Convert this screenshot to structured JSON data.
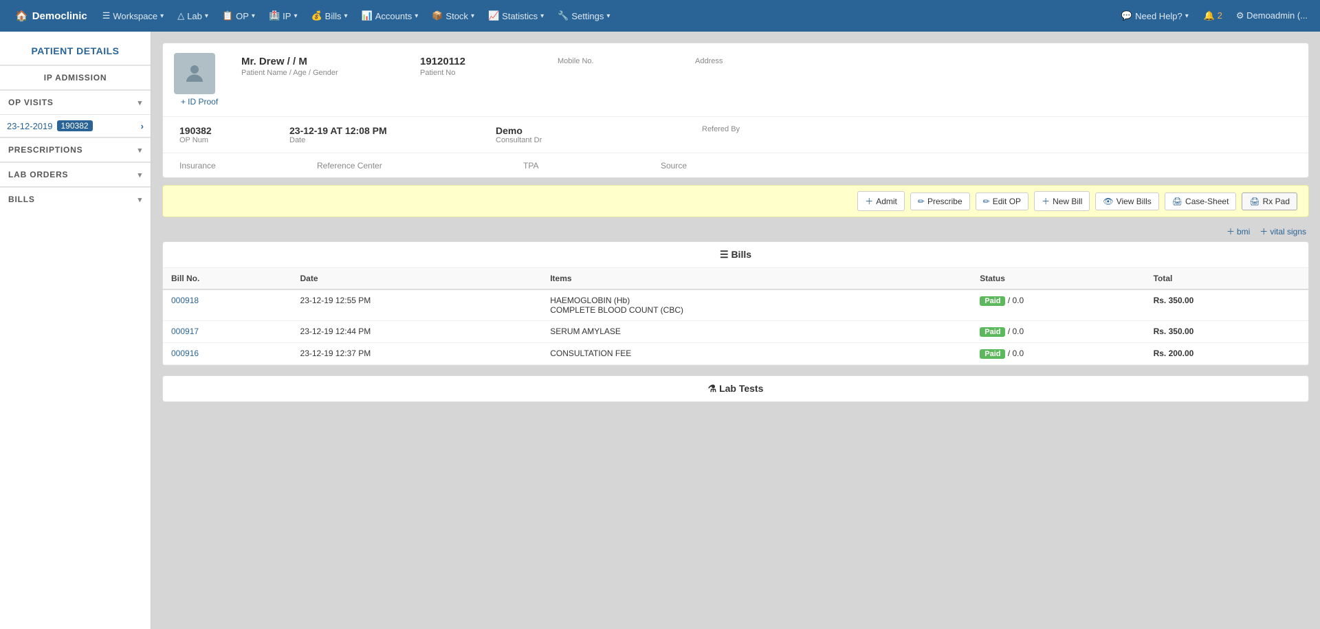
{
  "brand": {
    "icon": "🏠",
    "name": "Democlinic"
  },
  "nav": {
    "items": [
      {
        "id": "workspace",
        "label": "Workspace",
        "icon": "☰",
        "has_caret": true
      },
      {
        "id": "lab",
        "label": "Lab",
        "icon": "△",
        "has_caret": true
      },
      {
        "id": "op",
        "label": "OP",
        "icon": "📋",
        "has_caret": true
      },
      {
        "id": "ip",
        "label": "IP",
        "icon": "🏥",
        "has_caret": true
      },
      {
        "id": "bills",
        "label": "Bills",
        "icon": "💰",
        "has_caret": true
      },
      {
        "id": "accounts",
        "label": "Accounts",
        "icon": "📊",
        "has_caret": true
      },
      {
        "id": "stock",
        "label": "Stock",
        "icon": "📦",
        "has_caret": true
      },
      {
        "id": "statistics",
        "label": "Statistics",
        "icon": "📈",
        "has_caret": true
      },
      {
        "id": "settings",
        "label": "Settings",
        "icon": "🔧",
        "has_caret": true
      }
    ],
    "help": "Need Help?",
    "bell_count": "2",
    "admin": "Demoadmin (..."
  },
  "sidebar": {
    "title": "PATIENT DETAILS",
    "sections": [
      {
        "id": "ip-admission",
        "label": "IP ADMISSION",
        "has_caret": false
      },
      {
        "id": "op-visits",
        "label": "OP VISITS",
        "has_caret": true
      },
      {
        "id": "prescriptions",
        "label": "PRESCRIPTIONS",
        "has_caret": true
      },
      {
        "id": "lab-orders",
        "label": "LAB ORDERS",
        "has_caret": true
      },
      {
        "id": "bills",
        "label": "BILLS",
        "has_caret": true
      }
    ],
    "visit_date": "23-12-2019",
    "visit_badge": "190382"
  },
  "patient": {
    "name": "Mr. Drew / / M",
    "name_label": "Patient Name / Age / Gender",
    "number": "19120112",
    "number_label": "Patient No",
    "mobile_label": "Mobile No.",
    "address_label": "Address",
    "id_proof": "+ ID Proof"
  },
  "visit": {
    "op_num": "190382",
    "op_num_label": "OP Num",
    "date": "23-12-19 AT 12:08 PM",
    "date_label": "Date",
    "consultant": "Demo",
    "consultant_label": "Consultant Dr",
    "referred_label": "Refered By"
  },
  "meta": {
    "insurance_label": "Insurance",
    "reference_center_label": "Reference Center",
    "tpa_label": "TPA",
    "source_label": "Source"
  },
  "actions": {
    "admit": "Admit",
    "prescribe": "Prescribe",
    "edit_op": "Edit OP",
    "new_bill": "New Bill",
    "view_bills": "View Bills",
    "case_sheet": "Case-Sheet",
    "rx_pad": "Rx Pad"
  },
  "extras": {
    "bmi": "bmi",
    "vital_signs": "vital signs"
  },
  "bills_section": {
    "title": "Bills",
    "columns": [
      "Bill No.",
      "Date",
      "Items",
      "Status",
      "Total"
    ],
    "rows": [
      {
        "bill_no": "000918",
        "date": "23-12-19 12:55 PM",
        "items": "HAEMOGLOBIN (Hb)\nCOMPLETE BLOOD COUNT (CBC)",
        "items_line1": "HAEMOGLOBIN (Hb)",
        "items_line2": "COMPLETE BLOOD COUNT (CBC)",
        "status": "Paid",
        "status_extra": "/ 0.0",
        "total": "Rs. 350.00"
      },
      {
        "bill_no": "000917",
        "date": "23-12-19 12:44 PM",
        "items": "SERUM AMYLASE",
        "items_line1": "SERUM AMYLASE",
        "items_line2": "",
        "status": "Paid",
        "status_extra": "/ 0.0",
        "total": "Rs. 350.00"
      },
      {
        "bill_no": "000916",
        "date": "23-12-19 12:37 PM",
        "items": "CONSULTATION FEE",
        "items_line1": "CONSULTATION FEE",
        "items_line2": "",
        "status": "Paid",
        "status_extra": "/ 0.0",
        "total": "Rs. 200.00"
      }
    ]
  },
  "lab_section": {
    "title": "Lab Tests"
  }
}
